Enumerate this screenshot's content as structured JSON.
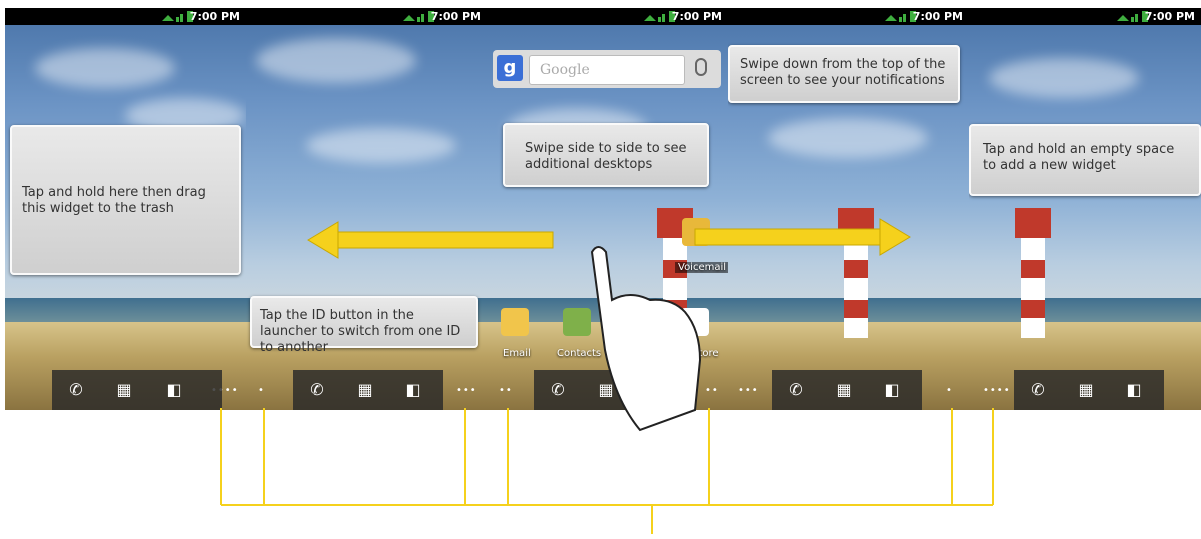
{
  "status_time": "7:00 PM",
  "tips": {
    "drag_widget": "Tap and hold here then drag this widget to the trash",
    "id_button": "Tap the ID button in the launcher to switch from one ID to another",
    "swipe_desktops": "Swipe side to side to see additional desktops",
    "notifications": "Swipe down from the top of the screen to see your notifications",
    "add_widget": "Tap and hold an empty space to add a new widget"
  },
  "search": {
    "placeholder": "Google"
  },
  "apps": {
    "voicemail": "Voicemail",
    "email": "Email",
    "contacts": "Contacts",
    "play_store": "y Store"
  },
  "icons": [
    "phone-icon",
    "apps-grid-icon",
    "id-icon",
    "mic-icon",
    "google-icon",
    "signal-icon",
    "battery-icon"
  ],
  "colors": {
    "callout_line": "#f5d11c",
    "arrow": "#f5d11c",
    "status_bar": "#000000"
  }
}
